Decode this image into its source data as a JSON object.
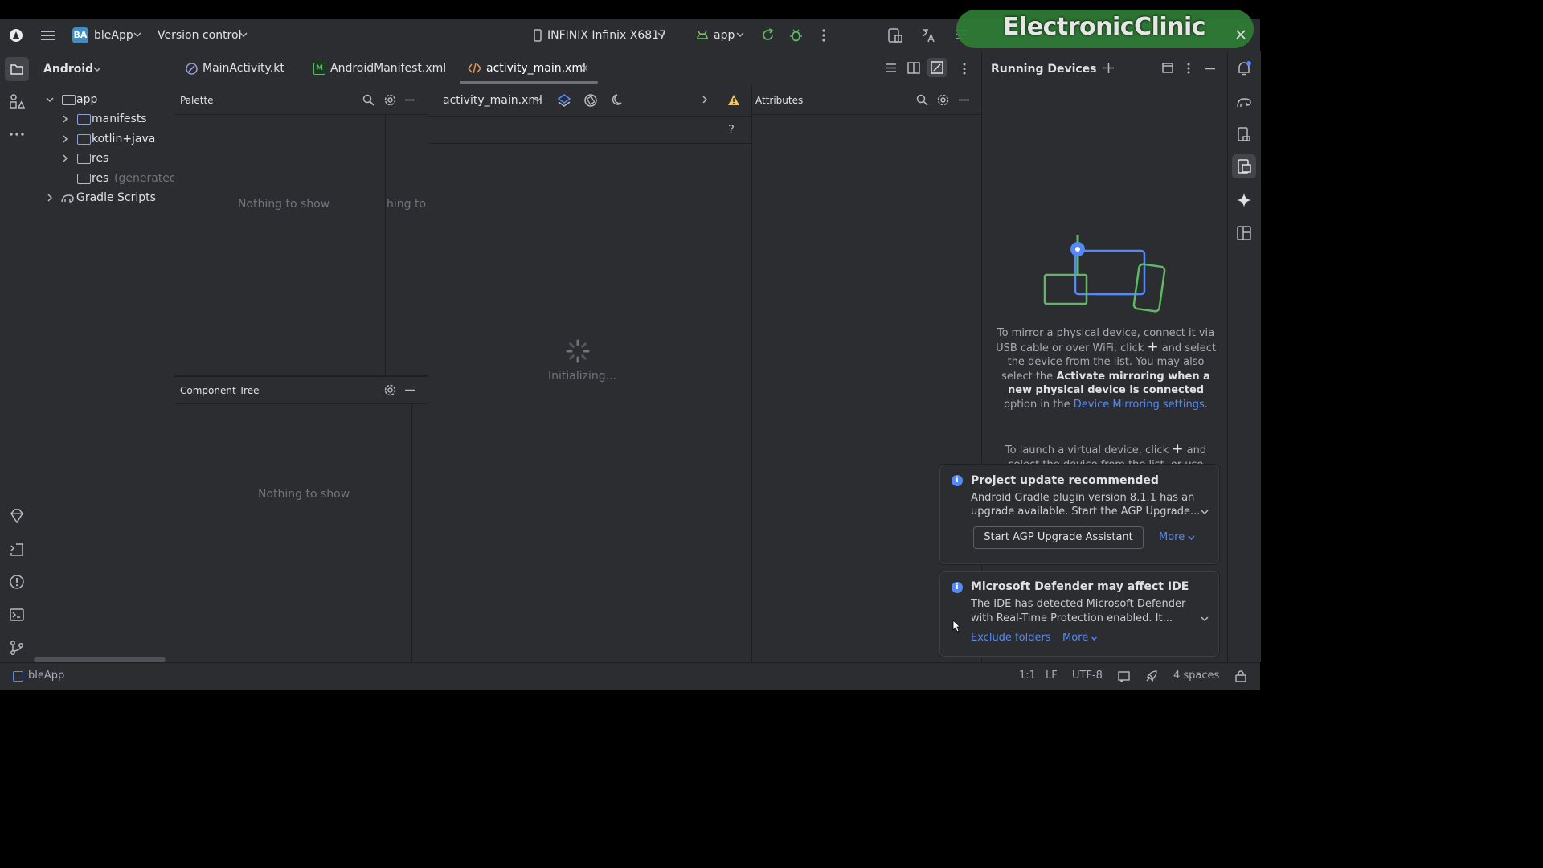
{
  "titlebar": {
    "project_badge": "BA",
    "project_name": "bleApp",
    "vcs_label": "Version control",
    "device": "INFINIX Infinix X6817",
    "run_config": "app",
    "watermark": "ElectronicClinic"
  },
  "project_panel": {
    "view_mode": "Android",
    "tree": [
      {
        "label": "app",
        "suffix": ""
      },
      {
        "label": "manifests",
        "suffix": ""
      },
      {
        "label": "kotlin+java",
        "suffix": ""
      },
      {
        "label": "res",
        "suffix": ""
      },
      {
        "label": "res",
        "suffix": "(generated)"
      },
      {
        "label": "Gradle Scripts",
        "suffix": ""
      }
    ]
  },
  "editor_tabs": [
    {
      "label": "MainActivity.kt"
    },
    {
      "label": "AndroidManifest.xml"
    },
    {
      "label": "activity_main.xml"
    }
  ],
  "palette": {
    "title": "Palette",
    "empty": "Nothing to show",
    "empty_clipped": "hing to s"
  },
  "component_tree": {
    "title": "Component Tree",
    "empty": "Nothing to show"
  },
  "design": {
    "file_select": "activity_main.xml",
    "help": "?",
    "status": "Initializing..."
  },
  "attributes": {
    "title": "Attributes"
  },
  "running_devices": {
    "title": "Running Devices",
    "p1_a": "To mirror a physical device, connect it via USB cable or over WiFi, click",
    "p1_b": "and select the device from the list. You may also select the",
    "p1_bold": "Activate mirroring when a new physical device is connected",
    "p1_c": "option in the",
    "p1_link": "Device Mirroring settings",
    "p2_a": "To launch a virtual device, click",
    "p2_b": "and",
    "p2_c": "select the device from the list, or use"
  },
  "notifications": [
    {
      "title": "Project update recommended",
      "body1": "Android Gradle plugin version 8.1.1 has an",
      "body2": "upgrade available. Start the AGP Upgrade...",
      "button": "Start AGP Upgrade Assistant",
      "more": "More"
    },
    {
      "title": "Microsoft Defender may affect IDE",
      "body1": "The IDE has detected Microsoft Defender",
      "body2": "with Real-Time Protection enabled. It...",
      "action": "Exclude folders",
      "more": "More"
    }
  ],
  "statusbar": {
    "project": "bleApp",
    "position": "1:1",
    "line_sep": "LF",
    "encoding": "UTF-8",
    "indent": "4 spaces"
  },
  "colors": {
    "accent": "#548af7",
    "background": "#2b2d30",
    "editor": "#1e1f22",
    "warning": "#f2c55c"
  }
}
